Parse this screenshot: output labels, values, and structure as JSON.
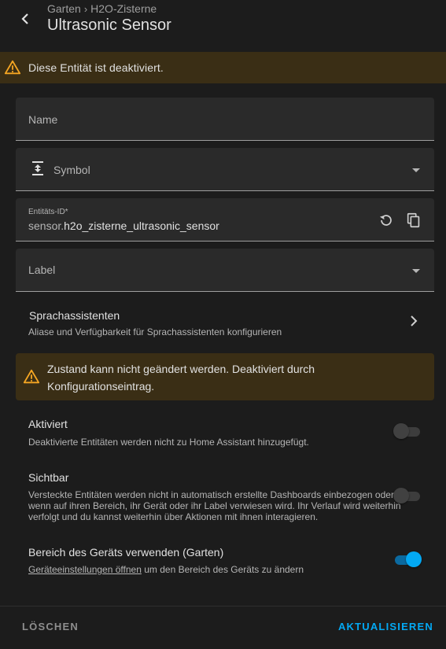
{
  "header": {
    "breadcrumb": [
      "Garten",
      "H2O-Zisterne"
    ],
    "breadcrumb_separator": "›",
    "title": "Ultrasonic Sensor"
  },
  "warning_banner": {
    "text": "Diese Entität ist deaktiviert.",
    "icon": "alert-triangle-icon"
  },
  "form": {
    "name_label": "Name",
    "symbol_label": "Symbol",
    "entity_id_label": "Entitäts-ID*",
    "entity_id_prefix": "sensor.",
    "entity_id_value": "h2o_zisterne_ultrasonic_sensor",
    "label_label": "Label"
  },
  "voice": {
    "title": "Sprachassistenten",
    "subtitle": "Aliase und Verfügbarkeit für Sprachassistenten konfigurieren"
  },
  "alert": {
    "text": "Zustand kann nicht geändert werden. Deaktiviert durch Konfigurationseintrag."
  },
  "settings": {
    "aktiviert": {
      "title": "Aktiviert",
      "desc": "Deaktivierte Entitäten werden nicht zu Home Assistant hinzugefügt.",
      "enabled": false
    },
    "sichtbar": {
      "title": "Sichtbar",
      "desc": "Versteckte Entitäten werden nicht in automatisch erstellte Dashboards einbezogen oder wenn auf ihren Bereich, ihr Gerät oder ihr Label verwiesen wird. Ihr Verlauf wird weiterhin verfolgt und du kannst weiterhin über Aktionen mit ihnen interagieren.",
      "enabled": false
    },
    "bereich": {
      "title": "Bereich des Geräts verwenden (Garten)",
      "link": "Geräteeinstellungen öffnen",
      "desc_rest": " um den Bereich des Geräts zu ändern",
      "enabled": true
    }
  },
  "footer": {
    "delete_label": "LÖSCHEN",
    "update_label": "AKTUALISIEREN"
  },
  "colors": {
    "accent": "#03a9f4",
    "warning": "#f5a623",
    "warning_bg": "#3a2e15",
    "background": "#1c1c1c",
    "field_bg": "#2a2a2a"
  }
}
